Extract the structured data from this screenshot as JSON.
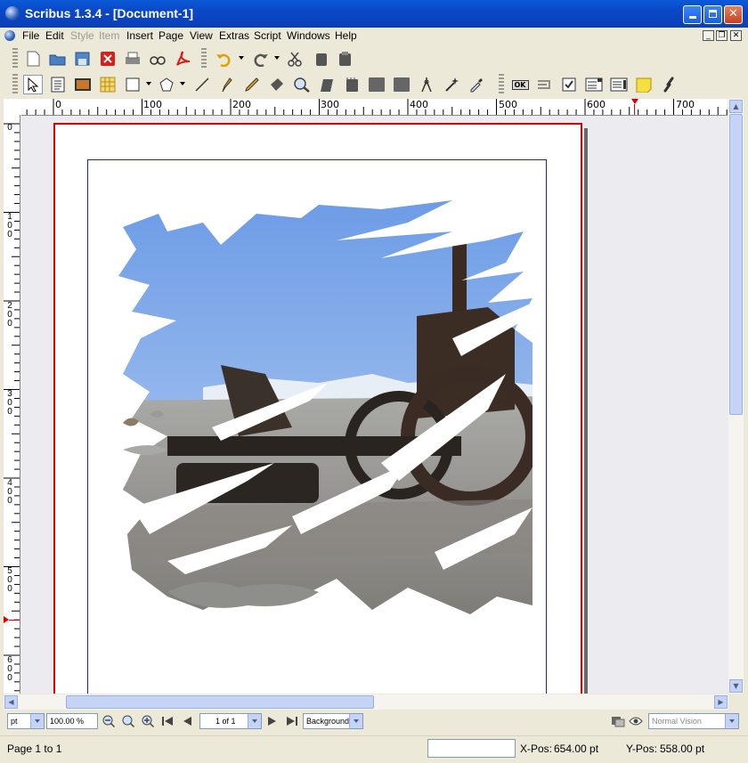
{
  "window": {
    "title": "Scribus 1.3.4 - [Document-1]"
  },
  "menu": [
    "File",
    "Edit",
    "Style",
    "Item",
    "Insert",
    "Page",
    "View",
    "Extras",
    "Script",
    "Windows",
    "Help"
  ],
  "menu_disabled": [
    "Style",
    "Item"
  ],
  "ruler": {
    "h_labels": [
      "0",
      "100",
      "200",
      "300",
      "400",
      "500",
      "600",
      "700"
    ],
    "v_labels": [
      "0",
      "1\n0\n0",
      "2\n0\n0",
      "3\n0\n0",
      "4\n0\n0",
      "5\n0\n0",
      "6\n0\n0"
    ]
  },
  "bottom": {
    "unit": "pt",
    "zoom": "100.00 %",
    "page_select": "1 of 1",
    "layer": "Background",
    "vision": "Normal Vision"
  },
  "status": {
    "page_info": "Page 1 to 1",
    "xpos_label": "X-Pos:",
    "xpos_value": "654.00 pt",
    "ypos_label": "Y-Pos:",
    "ypos_value": "558.00 pt"
  },
  "toolbar_buttons": {
    "ok": "OK"
  }
}
